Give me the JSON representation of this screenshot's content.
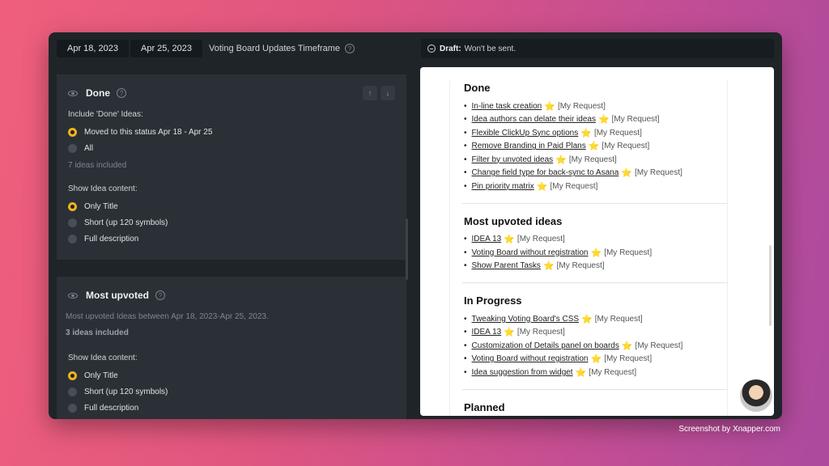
{
  "topbar": {
    "date_from": "Apr 18, 2023",
    "date_to": "Apr 25, 2023",
    "timeframe_label": "Voting Board Updates Timeframe",
    "help": "?"
  },
  "draft": {
    "label": "Draft:",
    "text": "Won't be sent."
  },
  "done_card": {
    "title": "Done",
    "include_label": "Include 'Done' Ideas:",
    "include_options": [
      "Moved to this status Apr 18 - Apr 25",
      "All"
    ],
    "included_count": "7 ideas included",
    "content_label": "Show Idea content:",
    "content_options": [
      "Only Title",
      "Short (up 120 symbols)",
      "Full description"
    ],
    "up": "↑",
    "down": "↓"
  },
  "upvoted_card": {
    "title": "Most upvoted",
    "description": "Most upvoted Ideas between Apr 18, 2023-Apr 25, 2023.",
    "included_count": "3 ideas included",
    "content_label": "Show Idea content:",
    "content_options": [
      "Only Title",
      "Short (up 120 symbols)",
      "Full description"
    ]
  },
  "preview": {
    "star": "⭐",
    "tag": "[My Request]",
    "sections": [
      {
        "title": "Done",
        "items": [
          "In-line task creation",
          "Idea authors can delate their ideas",
          "Flexible ClickUp Sync options",
          "Remove Branding in Paid Plans",
          "Filter by unvoted ideas",
          "Change field type for back-sync to Asana",
          "Pin priority matrix"
        ]
      },
      {
        "title": "Most upvoted ideas",
        "items": [
          "IDEA 13",
          "Voting Board without registration",
          "Show Parent Tasks"
        ]
      },
      {
        "title": "In Progress",
        "items": [
          "Tweaking Voting Board's CSS",
          "IDEA 13",
          "Customization of Details panel on boards",
          "Voting Board without registration",
          "Idea suggestion from widget"
        ]
      },
      {
        "title": "Planned",
        "items": []
      }
    ]
  },
  "footer": "Screenshot by Xnapper.com"
}
